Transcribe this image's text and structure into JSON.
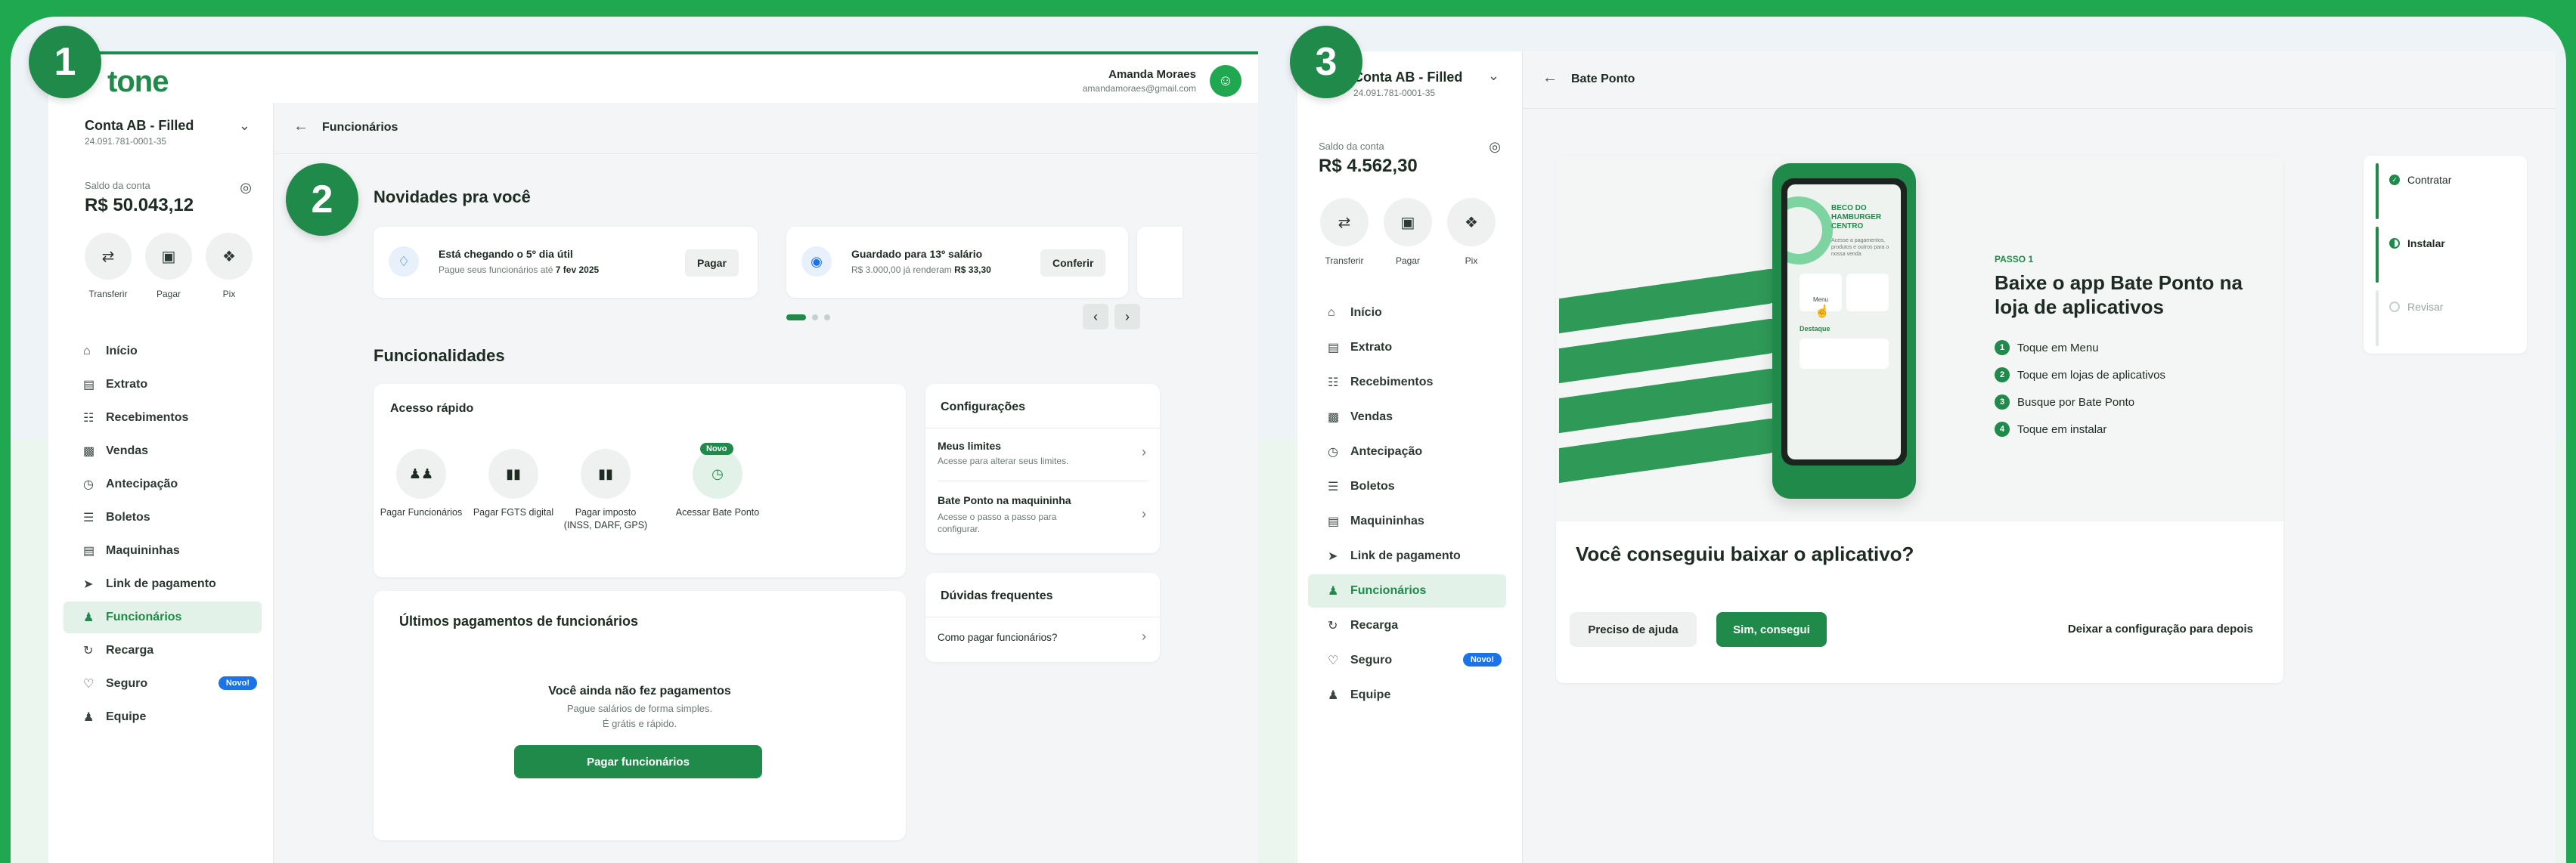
{
  "badges": [
    "1",
    "2",
    "3"
  ],
  "panel1": {
    "logo": "tone",
    "user": {
      "name": "Amanda Moraes",
      "email": "amandamoraes@gmail.com"
    },
    "account": {
      "name": "Conta AB - Filled",
      "number": "24.091.781-0001-35",
      "balance_label": "Saldo da conta",
      "balance": "R$ 50.043,12"
    },
    "quick": [
      "Transferir",
      "Pagar",
      "Pix"
    ],
    "nav": [
      "Início",
      "Extrato",
      "Recebimentos",
      "Vendas",
      "Antecipação",
      "Boletos",
      "Maquininhas",
      "Link de pagamento",
      "Funcionários",
      "Recarga",
      "Seguro",
      "Equipe"
    ],
    "nav_new_badge": "Novo!",
    "page_title": "Funcionários",
    "news_title": "Novidades pra você",
    "news": [
      {
        "title": "Está chegando o 5º dia útil",
        "sub_prefix": "Pague seus funcionários até ",
        "sub_bold": "7 fev 2025",
        "button": "Pagar"
      },
      {
        "title": "Guardado para 13º salário",
        "sub_prefix": "R$ 3.000,00 já renderam ",
        "sub_bold": "R$ 33,30",
        "button": "Conferir"
      }
    ],
    "features_title": "Funcionalidades",
    "quick_access_title": "Acesso rápido",
    "features": [
      {
        "label": "Pagar Funcionários"
      },
      {
        "label": "Pagar FGTS digital"
      },
      {
        "label": "Pagar imposto (INSS, DARF, GPS)"
      },
      {
        "label": "Acessar Bate Ponto",
        "tag": "Novo"
      }
    ],
    "config_title": "Configurações",
    "config": [
      {
        "title": "Meus limites",
        "sub": "Acesse para alterar seus limites."
      },
      {
        "title": "Bate Ponto na maquininha",
        "sub": "Acesse o passo a passo para configurar."
      }
    ],
    "faq_title": "Dúvidas frequentes",
    "faq": [
      "Como pagar funcionários?"
    ],
    "payments_title": "Últimos pagamentos de funcionários",
    "empty_title": "Você ainda não fez pagamentos",
    "empty_sub1": "Pague salários de forma simples.",
    "empty_sub2": "É grátis e rápido.",
    "pay_button": "Pagar funcionários"
  },
  "panel3": {
    "account": {
      "name": "Conta AB - Filled",
      "number": "24.091.781-0001-35",
      "balance_label": "Saldo da conta",
      "balance": "R$ 4.562,30"
    },
    "quick": [
      "Transferir",
      "Pagar",
      "Pix"
    ],
    "nav": [
      "Início",
      "Extrato",
      "Recebimentos",
      "Vendas",
      "Antecipação",
      "Boletos",
      "Maquininhas",
      "Link de pagamento",
      "Funcionários",
      "Recarga",
      "Seguro",
      "Equipe"
    ],
    "nav_new_badge": "Novo!",
    "page_title": "Bate Ponto",
    "phone": {
      "store": "BECO DO HAMBURGER CENTRO",
      "desc": "Acesse a pagamentos, produtos e outros para o nossa venda",
      "menu": "Menu",
      "highlight": "Destaque"
    },
    "step_label": "PASSO 1",
    "step_title": "Baixe o app Bate Ponto na loja de aplicativos",
    "steps": [
      "Toque em Menu",
      "Toque em lojas de aplicativos",
      "Busque por Bate Ponto",
      "Toque em instalar"
    ],
    "question": "Você conseguiu baixar o aplicativo?",
    "help_button": "Preciso de ajuda",
    "yes_button": "Sim, consegui",
    "later_link": "Deixar a configuração para depois",
    "progress": [
      "Contratar",
      "Instalar",
      "Revisar"
    ]
  }
}
